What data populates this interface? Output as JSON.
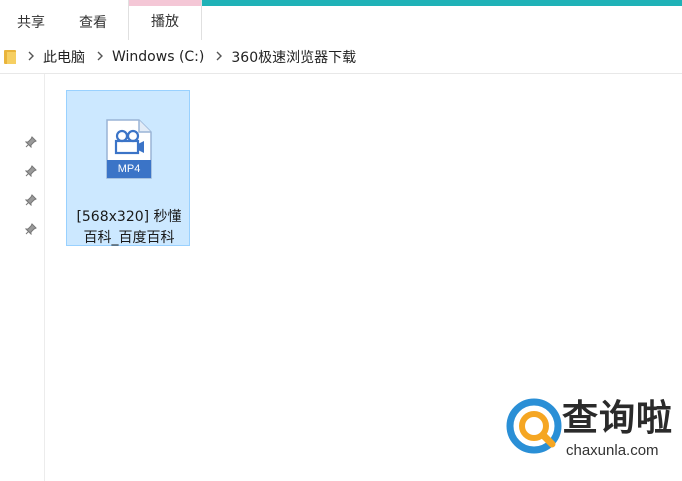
{
  "ribbon": {
    "tabs": [
      {
        "label": "共享"
      },
      {
        "label": "查看"
      },
      {
        "label": "播放"
      }
    ]
  },
  "address_bar": {
    "crumbs": [
      "此电脑",
      "Windows (C:)",
      "360极速浏览器下载"
    ],
    "separator": ">"
  },
  "nav_pane": {
    "pin_icon": "pin-icon"
  },
  "file": {
    "type_label": "MP4",
    "name_line1": "[568x320] 秒懂",
    "name_line2": "百科_百度百科",
    "selected": true
  },
  "watermark": {
    "brand": "查询啦",
    "url": "chaxunla.com"
  },
  "colors": {
    "ribbon_accent": "#1fb2b7",
    "selection_fill": "#cce8ff",
    "selection_border": "#99d1ff",
    "file_icon_blue": "#3b74c7",
    "watermark_blue": "#2a8fd6",
    "watermark_orange": "#f5a623"
  }
}
